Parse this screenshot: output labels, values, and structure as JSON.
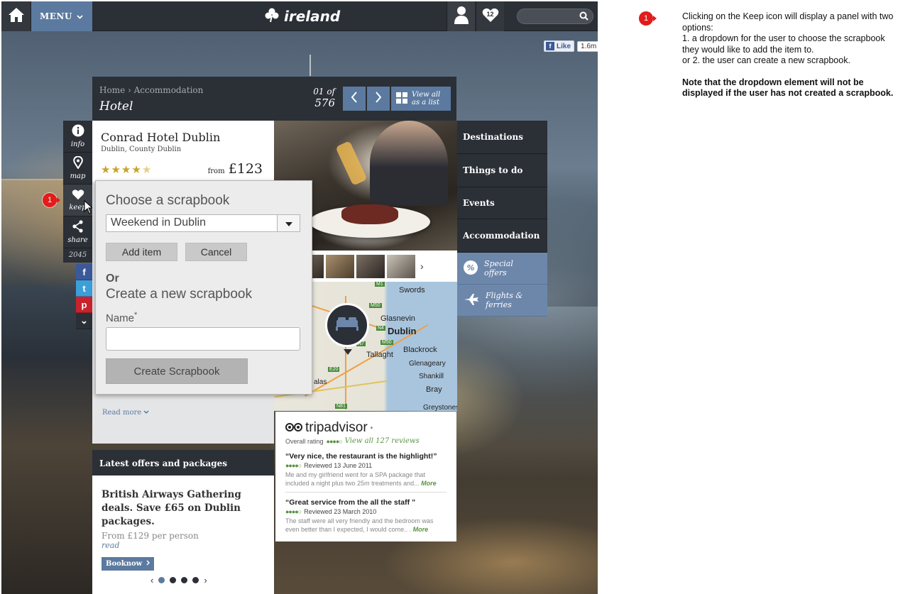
{
  "nav": {
    "menu_label": "MENU",
    "brand": "ireland",
    "favourites_count": "12"
  },
  "facebook": {
    "like_label": "Like",
    "like_count": "1.6m"
  },
  "header": {
    "breadcrumb": "Home › Accommodation",
    "title": "Hotel",
    "counter_top": "01 of",
    "counter_total": "576",
    "view_all_line1": "View all",
    "view_all_line2": "as a list"
  },
  "actions": [
    {
      "label": "info",
      "icon": "info-icon"
    },
    {
      "label": "map",
      "icon": "map-pin-icon"
    },
    {
      "label": "keep",
      "icon": "heart-icon"
    },
    {
      "label": "share",
      "icon": "share-icon"
    }
  ],
  "share_count": "2045",
  "social": [
    "f",
    "t",
    "p",
    "⌄"
  ],
  "hotel": {
    "name": "Conrad Hotel Dublin",
    "location": "Dublin, County Dublin",
    "rating": 4,
    "price_from": "from",
    "price": "£123",
    "read_more": "Read more"
  },
  "scrapbook": {
    "choose_title": "Choose a scrapbook",
    "selected": "Weekend in Dublin",
    "add_label": "Add item",
    "cancel_label": "Cancel",
    "or_label": "Or",
    "create_title": "Create a new scrapbook",
    "name_label": "Name",
    "name_required": "*",
    "name_value": "",
    "create_label": "Create Scrapbook"
  },
  "offers": {
    "heading": "Latest offers and packages",
    "title": "British Airways Gathering deals. Save £65 on Dublin packages.",
    "price": "From £129 per person",
    "read": "read",
    "book_label": "Booknow",
    "slides": 4,
    "active_slide": 1
  },
  "side_menu": [
    "Destinations",
    "Things to do",
    "Events",
    "Accommodation"
  ],
  "side_promo": [
    {
      "line1": "Special",
      "line2": "offers",
      "icon": "percent-icon"
    },
    {
      "line1": "Flights &",
      "line2": "ferries",
      "icon": "plane-icon"
    }
  ],
  "map": {
    "labels": [
      "Swords",
      "Glasnevin",
      "Dublin",
      "Blackrock",
      "Tallaght",
      "Glenageary",
      "Shankill",
      "Bray",
      "Greystones",
      "alas"
    ],
    "shields": [
      "M1",
      "M50",
      "N3",
      "N4",
      "N7",
      "N81",
      "M50",
      "E20",
      "N11"
    ]
  },
  "tripadvisor": {
    "brand": "tripadvisor",
    "overall": "Overall rating",
    "view_all": "View all 127 reviews",
    "reviews": [
      {
        "title": "“Very nice, the restaurant is the highlight!”",
        "date": "Reviewed 13 June 2011",
        "text": "Me and my girlfriend went for a SPA package that included a night plus two 25m treatments and...",
        "more": "More"
      },
      {
        "title": "“Great service from the all the staff ”",
        "date": "Reviewed 23 March 2010",
        "text": "The staff were all very friendly and the bedroom was even better than I expected, I would come.. .",
        "more": "More"
      }
    ]
  },
  "callout": {
    "number": "1",
    "line1": "Clicking on the Keep icon will display a panel with two options:",
    "line2": "1. a dropdown for the user to choose the scrapbook they would like to add the item to.",
    "line3": "or 2. the user can create a new scrapbook.",
    "note": "Note that the dropdown element will not be displayed if the user has not created a scrapbook."
  },
  "colors": {
    "accent": "#5c7a9f",
    "dark": "#2b2f36",
    "marker": "#e21b1b",
    "tripadvisor": "#589442"
  }
}
